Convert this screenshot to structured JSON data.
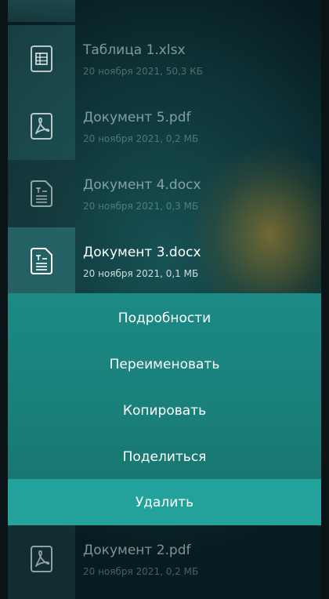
{
  "files": [
    {
      "name": "Таблица 1.xlsx",
      "meta": "20 ноября 2021, 50,3 КБ",
      "icon": "spreadsheet-icon"
    },
    {
      "name": "Документ 5.pdf",
      "meta": "20 ноября 2021, 0,2 МБ",
      "icon": "pdf-icon"
    },
    {
      "name": "Документ 4.docx",
      "meta": "20 ноября 2021, 0,3 МБ",
      "icon": "text-document-icon"
    },
    {
      "name": "Документ 3.docx",
      "meta": "20 ноября 2021, 0,1 МБ",
      "icon": "text-document-icon",
      "selected": true
    },
    {
      "name": "Документ 2.pdf",
      "meta": "20 ноября 2021, 0,2 МБ",
      "icon": "pdf-icon"
    }
  ],
  "context_menu": {
    "items": [
      {
        "label": "Подробности"
      },
      {
        "label": "Переименовать"
      },
      {
        "label": "Копировать"
      },
      {
        "label": "Поделиться"
      },
      {
        "label": "Удалить",
        "highlighted": true
      }
    ]
  },
  "colors": {
    "menu_background": "#1c8a85",
    "menu_highlight": "#23a29b",
    "icon_stroke": "#ffffff"
  }
}
